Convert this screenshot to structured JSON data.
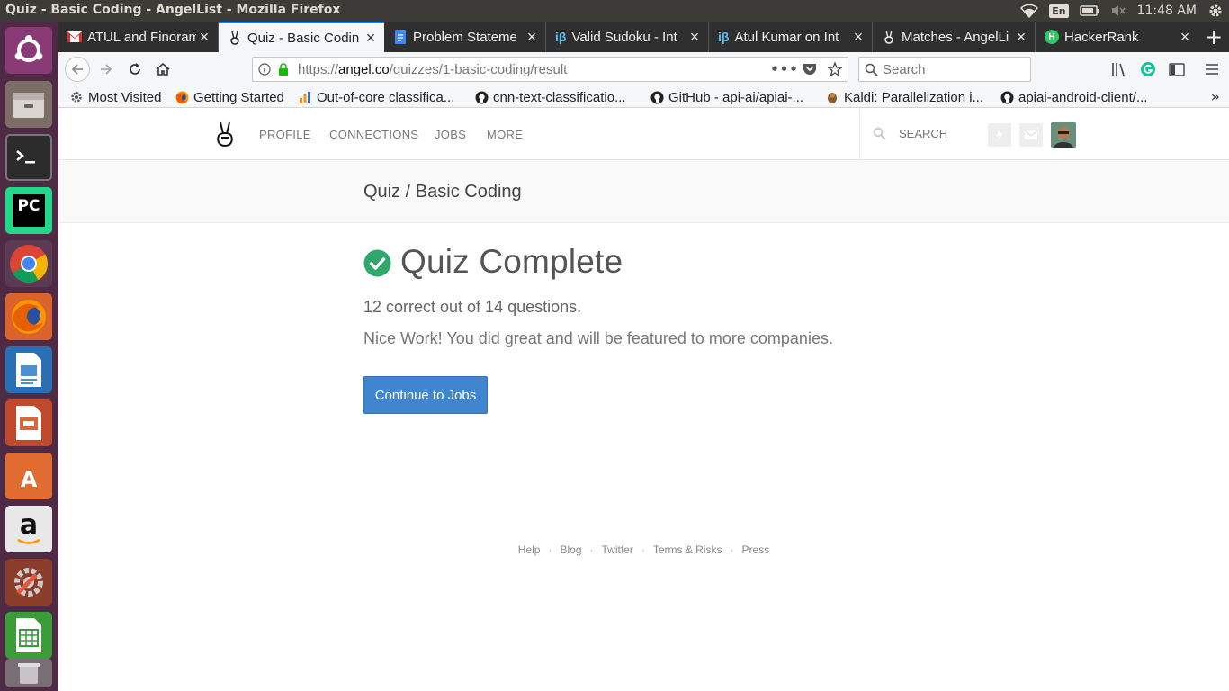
{
  "system": {
    "window_title": "Quiz - Basic Coding - AngelList - Mozilla Firefox",
    "keyboard_layout": "En",
    "clock": "11:48 AM"
  },
  "launcher": {
    "apps": [
      {
        "name": "Ubuntu Dash",
        "icon": "ubuntu-logo-icon"
      },
      {
        "name": "Files",
        "icon": "files-icon"
      },
      {
        "name": "Terminal",
        "icon": "terminal-icon"
      },
      {
        "name": "PyCharm",
        "icon": "pycharm-icon",
        "label": "PC"
      },
      {
        "name": "Google Chrome",
        "icon": "chrome-icon"
      },
      {
        "name": "Firefox",
        "icon": "firefox-icon"
      },
      {
        "name": "LibreOffice Writer",
        "icon": "writer-icon"
      },
      {
        "name": "LibreOffice Impress",
        "icon": "impress-icon"
      },
      {
        "name": "Ubuntu Software",
        "icon": "store-icon",
        "label": "A"
      },
      {
        "name": "Amazon",
        "icon": "amazon-icon",
        "label": "a"
      },
      {
        "name": "System Settings",
        "icon": "settings-icon"
      },
      {
        "name": "LibreOffice Calc",
        "icon": "calc-icon"
      },
      {
        "name": "Trash",
        "icon": "trash-icon"
      }
    ]
  },
  "browser": {
    "tabs": [
      {
        "label": "ATUL and Finoram",
        "favicon": "gmail-icon"
      },
      {
        "label": "Quiz - Basic Codin",
        "favicon": "angellist-icon",
        "active": true
      },
      {
        "label": "Problem Stateme",
        "favicon": "google-docs-icon"
      },
      {
        "label": "Valid Sudoku - Int",
        "favicon": "interviewbit-icon",
        "favicon_text": "iβ"
      },
      {
        "label": "Atul Kumar on Int",
        "favicon": "interviewbit-icon",
        "favicon_text": "iβ"
      },
      {
        "label": "Matches - AngelLi",
        "favicon": "angellist-icon"
      },
      {
        "label": "HackerRank",
        "favicon": "hackerrank-icon",
        "favicon_text": "H"
      }
    ],
    "url": {
      "scheme": "https://",
      "host": "angel.co",
      "path": "/quizzes/1-basic-coding/result"
    },
    "search_placeholder": "Search",
    "bookmarks": [
      {
        "label": "Most Visited",
        "favicon": "gear-icon"
      },
      {
        "label": "Getting Started",
        "favicon": "firefox-icon"
      },
      {
        "label": "Out-of-core classifica...",
        "favicon": "chart-icon"
      },
      {
        "label": "cnn-text-classificatio...",
        "favicon": "github-icon"
      },
      {
        "label": "GitHub - api-ai/apiai-...",
        "favicon": "github-icon"
      },
      {
        "label": "Kaldi: Parallelization i...",
        "favicon": "kaldi-icon"
      },
      {
        "label": "apiai-android-client/...",
        "favicon": "github-icon"
      }
    ]
  },
  "angellist": {
    "nav": [
      "PROFILE",
      "CONNECTIONS",
      "JOBS",
      "MORE"
    ],
    "search_placeholder": "SEARCH",
    "breadcrumb": "Quiz / Basic Coding",
    "result": {
      "title": "Quiz Complete",
      "score_text": "12 correct out of 14 questions.",
      "correct": 12,
      "total": 14,
      "message": "Nice Work! You did great and will be featured to more companies.",
      "button_label": "Continue to Jobs"
    },
    "footer": [
      "Help",
      "Blog",
      "Twitter",
      "Terms & Risks",
      "Press"
    ]
  },
  "colors": {
    "success_green": "#2ea86b",
    "primary_button": "#3f86cf",
    "launcher_bg": "#4f2a45",
    "topbar_bg": "#3c3b37",
    "tabstrip_bg": "#2f2f2f",
    "active_tab_accent": "#0a84ff"
  }
}
